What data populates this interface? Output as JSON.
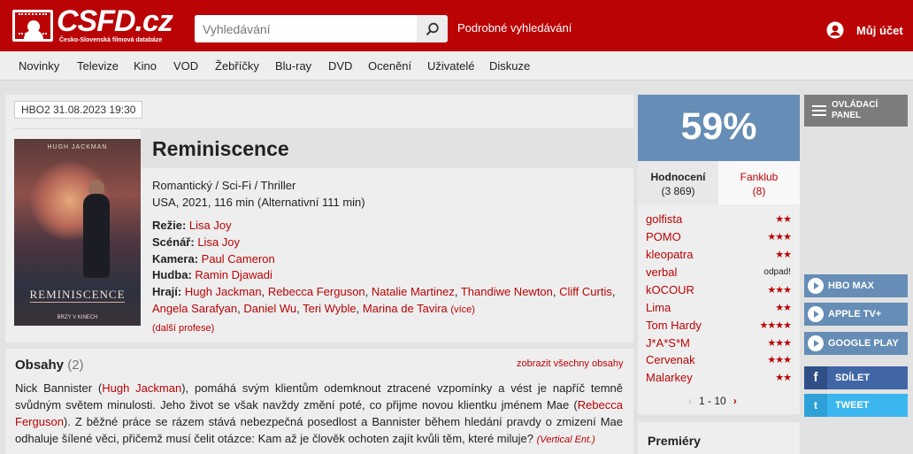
{
  "header": {
    "logo_text": "CSFD.cz",
    "logo_subtitle": "Česko-Slovenská filmová databáze",
    "search_placeholder": "Vyhledávání",
    "advanced_search": "Podrobné vyhledávání",
    "account": "Můj účet"
  },
  "nav": [
    "Novinky",
    "Televize",
    "Kino",
    "VOD",
    "Žebříčky",
    "Blu-ray",
    "DVD",
    "Ocenění",
    "Uživatelé",
    "Diskuze"
  ],
  "film": {
    "tv_badge": "HBO2 31.08.2023 19:30",
    "poster_top": "HUGH JACKMAN",
    "poster_title": "REMINISCENCE",
    "poster_bottom": "BRZY V KINECH",
    "title": "Reminiscence",
    "genres": "Romantický / Sci-Fi / Thriller",
    "origin": "USA, 2021, 116 min (Alternativní 111 min)",
    "director_label": "Režie:",
    "director": "Lisa Joy",
    "writer_label": "Scénář:",
    "writer": "Lisa Joy",
    "camera_label": "Kamera:",
    "camera": "Paul Cameron",
    "music_label": "Hudba:",
    "music": "Ramin Djawadi",
    "cast_label": "Hrají:",
    "cast": [
      "Hugh Jackman",
      "Rebecca Ferguson",
      "Natalie Martinez",
      "Thandiwe Newton",
      "Cliff Curtis",
      "Angela Sarafyan",
      "Daniel Wu",
      "Teri Wyble",
      "Marina de Tavira"
    ],
    "cast_more": "(více)",
    "more_profiles": "(další profese)"
  },
  "synopsis": {
    "title": "Obsahy",
    "count": "(2)",
    "show_all": "zobrazit všechny obsahy",
    "part1": "Nick Bannister (",
    "link1": "Hugh Jackman",
    "part2": "), pomáhá svým klientům odemknout ztracené vzpomínky a vést je napříč temně svůdným světem minulosti. Jeho život se však navždy změní poté, co přijme novou klientku jménem Mae (",
    "link2": "Rebecca Ferguson",
    "part3": "). Z běžné práce se rázem stává nebezpečná posedlost a Bannister během hledání pravdy o zmizení Mae odhaluje šílené věci, přičemž musí čelit otázce: Kam až je člověk ochoten zajít kvůli těm, které miluje?",
    "source": "(Vertical Ent.)"
  },
  "rating": {
    "value": "59%",
    "tab1_label": "Hodnocení",
    "tab1_count": "(3 869)",
    "tab2_label": "Fanklub",
    "tab2_count": "(8)",
    "users": [
      {
        "name": "golfista",
        "stars": "★★",
        "star_count": 2
      },
      {
        "name": "POMO",
        "stars": "★★★",
        "star_count": 3
      },
      {
        "name": "kleopatra",
        "stars": "★★",
        "star_count": 2
      },
      {
        "name": "verbal",
        "stars": "odpad!",
        "star_count": 0
      },
      {
        "name": "kOCOUR",
        "stars": "★★★",
        "star_count": 3
      },
      {
        "name": "Lima",
        "stars": "★★",
        "star_count": 2
      },
      {
        "name": "Tom Hardy",
        "stars": "★★★★",
        "star_count": 4
      },
      {
        "name": "J*A*S*M",
        "stars": "★★★",
        "star_count": 3
      },
      {
        "name": "Cervenak",
        "stars": "★★★",
        "star_count": 3
      },
      {
        "name": "Malarkey",
        "stars": "★★",
        "star_count": 2
      }
    ],
    "pager_prev": "‹",
    "pager": "1 - 10",
    "pager_next": "›",
    "premiery": "Premiéry"
  },
  "side": {
    "control_panel": "OVLÁDACÍ PANEL",
    "control_panel_l1": "OVLÁDACÍ",
    "control_panel_l2": "PANEL",
    "services": [
      "HBO MAX",
      "APPLE TV+",
      "GOOGLE PLAY"
    ],
    "share": "SDÍLET",
    "tweet": "TWEET",
    "fb_icon": "f",
    "tw_icon": "t"
  },
  "colors": {
    "brand_red": "#ba0305",
    "rating_blue": "#658db5",
    "facebook": "#4166a6",
    "twitter": "#3bb6ee"
  }
}
